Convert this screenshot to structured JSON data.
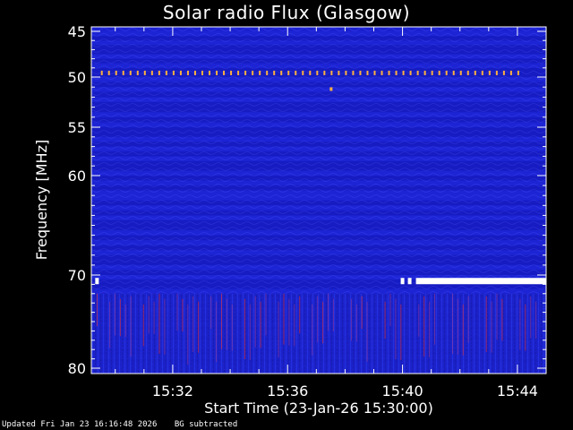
{
  "footer": {
    "updated": "Updated Fri Jan 23 16:16:48 2026",
    "bg_note": "BG subtracted"
  },
  "chart_data": {
    "type": "heatmap",
    "title": "Solar radio Flux (Glasgow)",
    "xlabel": "Start Time (23-Jan-26 15:30:00)",
    "ylabel": "Frequency [MHz]",
    "x_unit": "time (HH:MM)",
    "xlim": [
      "15:29:10",
      "15:45:00"
    ],
    "x_ticks": [
      "15:32",
      "15:36",
      "15:40",
      "15:44"
    ],
    "x_minor_ticks_minutes": [
      "15:30",
      "15:31",
      "15:33",
      "15:34",
      "15:35",
      "15:37",
      "15:38",
      "15:39",
      "15:41",
      "15:42",
      "15:43",
      "15:45"
    ],
    "ylim": [
      45,
      80
    ],
    "y_axis_direction": "inverted",
    "y_ticks": [
      45,
      50,
      55,
      60,
      70,
      80
    ],
    "colormap": [
      "#000060",
      "#1a20d0",
      "#2a36e8",
      "#7a40c0",
      "#ff3020",
      "#ffd040",
      "#ffffff"
    ],
    "background_intensity": "low (blue)",
    "features": [
      {
        "name": "narrowband interference",
        "frequency_mhz": 49.6,
        "time_start": "15:29:30",
        "time_end": "15:44:00",
        "appearance": "periodic dots",
        "color": "#ffb040"
      },
      {
        "name": "spot",
        "frequency_mhz": 51.2,
        "time": "15:37:30",
        "color": "#ffb040"
      },
      {
        "name": "saturated band",
        "frequency_mhz": 70.6,
        "time_start": "15:40:00",
        "time_end": "15:45:00",
        "appearance": "segmented white bar",
        "color": "#ffffff"
      },
      {
        "name": "saturated band start marker",
        "frequency_mhz": 70.6,
        "time": "15:29:20",
        "color": "#ffffff"
      },
      {
        "name": "broadband vertical streaks",
        "frequency_range_mhz": [
          72,
          78
        ],
        "appearance": "faint red/white vertical streaks",
        "color": "#c04080"
      }
    ]
  }
}
